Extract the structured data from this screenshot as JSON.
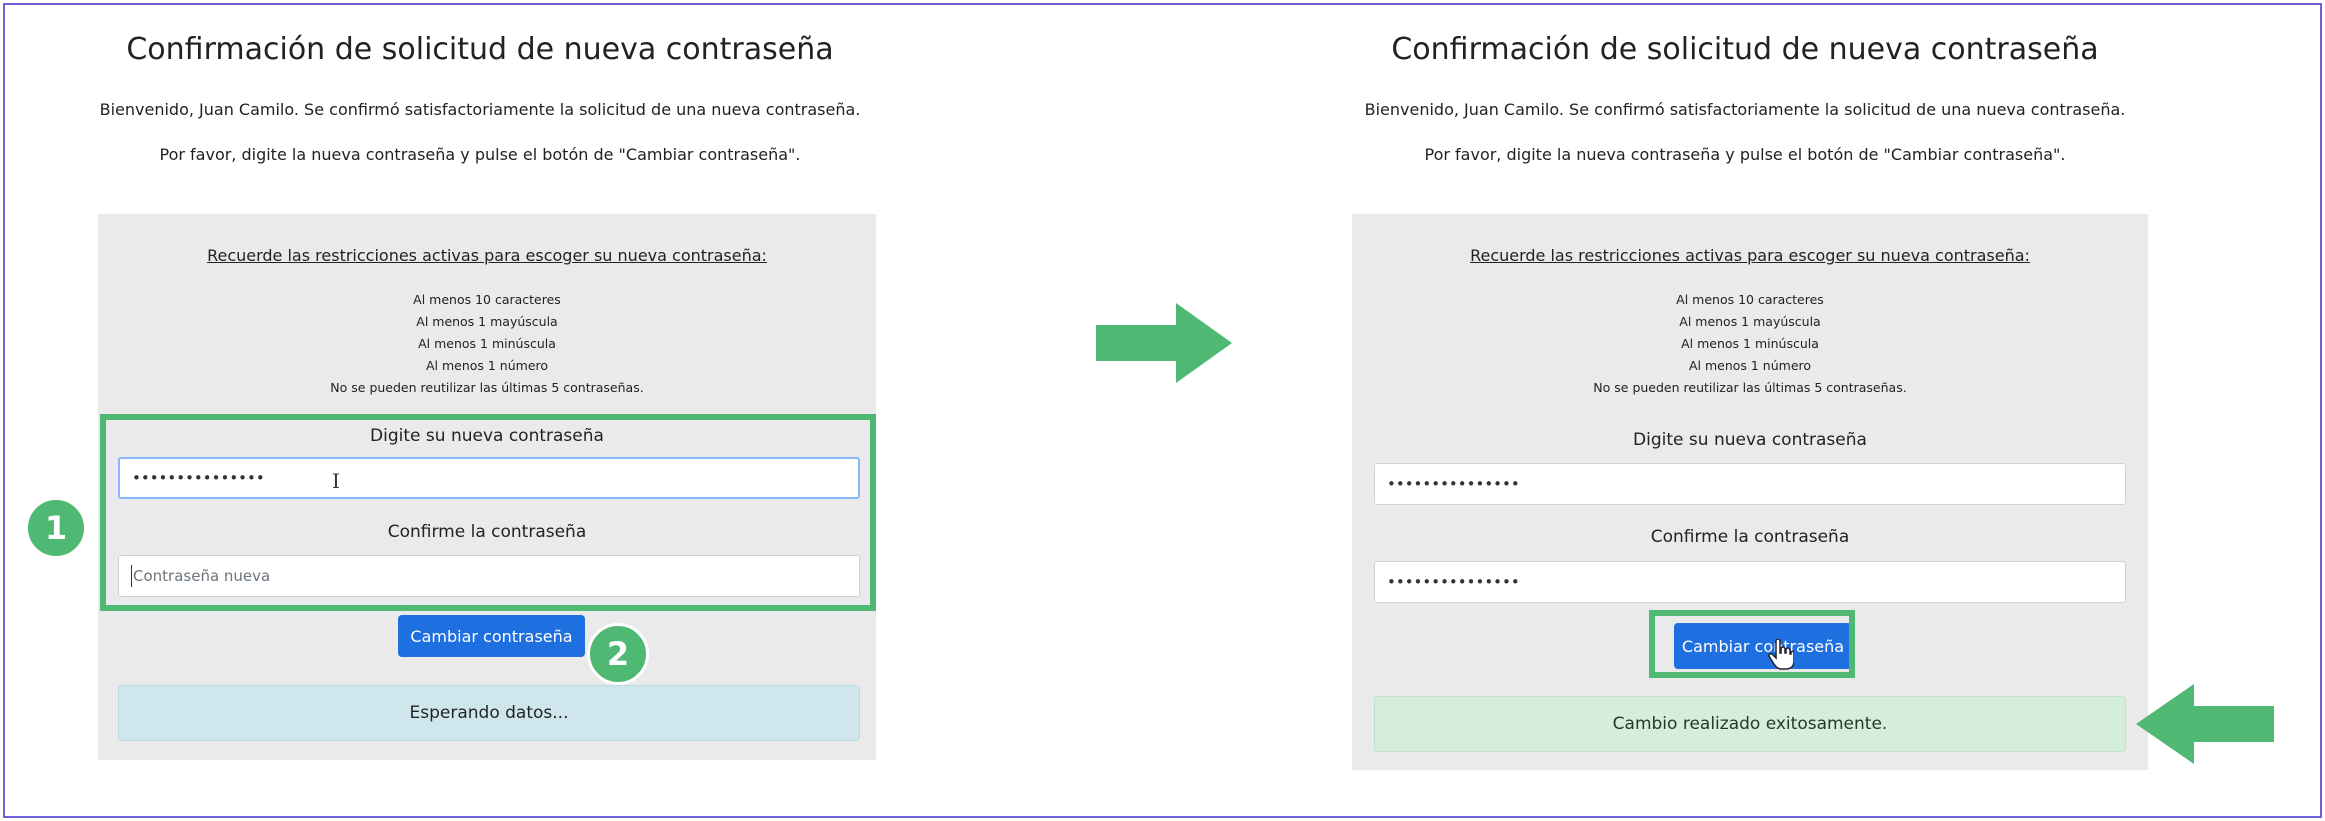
{
  "title": "Confirmación de solicitud de nueva contraseña",
  "welcome": "Bienvenido, Juan Camilo. Se confirmó satisfactoriamente la solicitud de una nueva contraseña.",
  "instruction": "Por favor, digite la nueva contraseña y pulse el botón de \"Cambiar contraseña\".",
  "restrictions": {
    "heading": "Recuerde las restricciones activas para escoger su nueva contraseña:",
    "items": [
      "Al menos 10 caracteres",
      "Al menos 1 mayúscula",
      "Al menos 1 minúscula",
      "Al menos 1 número",
      "No se pueden reutilizar las últimas 5 contraseñas."
    ]
  },
  "form": {
    "new_password_label": "Digite su nueva contraseña",
    "confirm_label": "Confirme la contraseña",
    "masked_value": "•••••••••••••••",
    "confirm_placeholder": "Contraseña nueva",
    "submit_label": "Cambiar contraseña"
  },
  "status": {
    "waiting": "Esperando datos...",
    "success": "Cambio realizado exitosamente."
  },
  "annotations": {
    "step1": "1",
    "step2": "2",
    "accent_color": "#4fb873",
    "icons": [
      "arrow-right-icon",
      "arrow-left-icon",
      "text-cursor-icon",
      "hand-pointer-icon"
    ]
  }
}
